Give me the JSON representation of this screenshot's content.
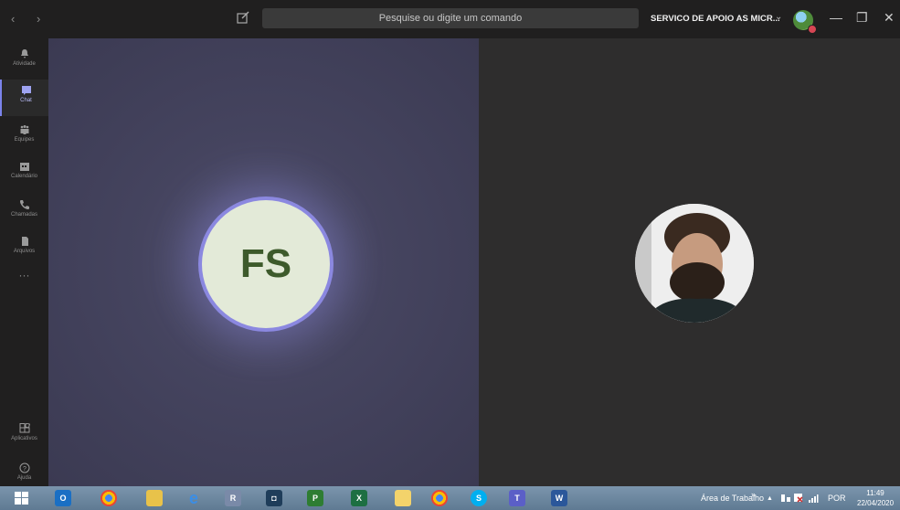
{
  "titlebar": {
    "nav_arrows": "‹  ›",
    "search_placeholder": "Pesquise ou digite um comando",
    "tenant_name": "SERVICO DE APOIO AS MICR...",
    "tenant_chevron": "⌄",
    "win_minimize": "—",
    "win_maximize": "❐",
    "win_close": "✕"
  },
  "sidebar": {
    "items": [
      {
        "label": "Atividade",
        "icon": "bell-icon"
      },
      {
        "label": "Chat",
        "icon": "chat-icon"
      },
      {
        "label": "Equipes",
        "icon": "teams-icon"
      },
      {
        "label": "Calendário",
        "icon": "calendar-icon"
      },
      {
        "label": "Chamadas",
        "icon": "phone-icon"
      },
      {
        "label": "Arquivos",
        "icon": "file-icon"
      }
    ],
    "more": "···",
    "bottom": [
      {
        "label": "Aplicativos",
        "icon": "apps-icon"
      },
      {
        "label": "Ajuda",
        "icon": "help-icon"
      }
    ]
  },
  "call": {
    "participant_initials": "FS"
  },
  "taskbar": {
    "desktop_label": "Área de Trabalho",
    "chevron": "»",
    "tray_arrow": "▲",
    "language": "POR",
    "time": "11:49",
    "date": "22/04/2020"
  },
  "colors": {
    "accent": "#7b83eb",
    "stage_left": "#45445f",
    "avatar_bg": "#e3ead8",
    "initials": "#3d5a2b",
    "presence_busy": "#d74654"
  }
}
